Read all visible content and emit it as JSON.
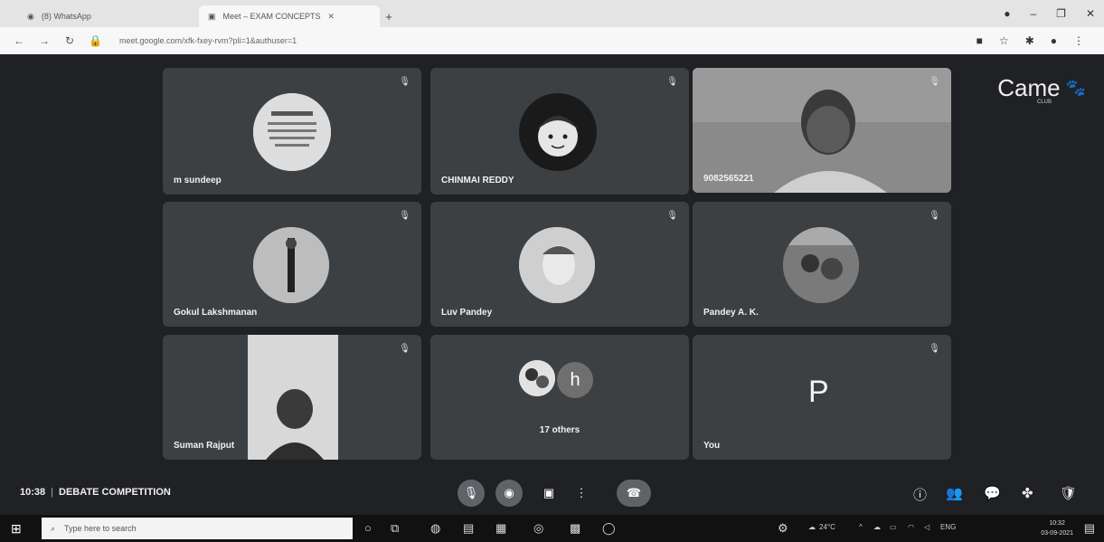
{
  "browser": {
    "tabs": [
      {
        "label": "(8) WhatsApp",
        "active": false
      },
      {
        "label": "Meet – EXAM CONCEPTS",
        "active": true
      }
    ],
    "url": "meet.google.com/xfk-fxey-rvm?pli=1&authuser=1"
  },
  "meet": {
    "brand": "Came",
    "brand_sub": "CLUB",
    "participants": [
      {
        "name": "m sundeep",
        "avatar_type": "sign-image"
      },
      {
        "name": "CHINMAI REDDY",
        "avatar_type": "cartoon-face"
      },
      {
        "name": "9082565221",
        "avatar_type": "video"
      },
      {
        "name": "Gokul Lakshmanan",
        "avatar_type": "photo"
      },
      {
        "name": "Luv Pandey",
        "avatar_type": "photo"
      },
      {
        "name": "Pandey A. K.",
        "avatar_type": "photo"
      },
      {
        "name": "Suman Rajput",
        "avatar_type": "video"
      },
      {
        "name": "17 others",
        "avatar_letter": "h"
      },
      {
        "name": "You",
        "avatar_letter": "P"
      }
    ],
    "time": "10:38",
    "meeting_title": "DEBATE COMPETITION"
  },
  "taskbar": {
    "search_placeholder": "Type here to search",
    "temperature": "24°C",
    "language": "ENG",
    "clock_time": "10:32",
    "clock_date": "03-09-2021"
  },
  "colors": {
    "meet_bg": "#202124",
    "tile_bg": "#3c4043",
    "control_bg": "#5f6368"
  }
}
